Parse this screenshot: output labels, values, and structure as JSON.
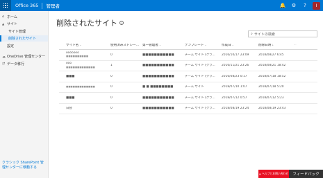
{
  "suite": {
    "brand": "Office 365",
    "app_title": "管理者",
    "bell_icon": "bell-icon",
    "gear_icon": "gear-icon",
    "help_icon": "question-icon",
    "avatar_initial": "I"
  },
  "nav": {
    "items": [
      {
        "label": "ホーム",
        "icon": "home-icon",
        "toggle": ""
      },
      {
        "label": "サイト",
        "icon": "",
        "toggle": "chevron-up-icon"
      },
      {
        "label": "サイト管理",
        "icon": "",
        "toggle": ""
      },
      {
        "label": "削除されたサイト",
        "icon": "",
        "toggle": ""
      },
      {
        "label": "設定",
        "icon": "",
        "toggle": ""
      },
      {
        "label": "OneDrive 管理センター",
        "icon": "onedrive-icon",
        "toggle": ""
      },
      {
        "label": "データ移行",
        "icon": "migration-icon",
        "toggle": ""
      }
    ],
    "classic_link": "クラシック SharePoint 管理センターに移動する"
  },
  "page": {
    "title": "削除されたサイト",
    "search_placeholder": "サイトの検索"
  },
  "grid": {
    "columns": [
      "サイト名",
      "使用済みストレー...",
      "第一管理者",
      "テンプレート",
      "作成日",
      "削除日時"
    ],
    "rows": [
      {
        "name": "ooooooo",
        "name_sub": "■■■■■■■■■■",
        "storage": "0",
        "admin": "■■■■■■■■■■■",
        "template": "チーム サイト (クラ...",
        "created": "2016/10/17 23:09",
        "deleted": "2018/08/27 6:45"
      },
      {
        "name": "ooo",
        "name_sub": "■■■■■■■■■■■■■",
        "storage": "1",
        "admin": "■■■■■■■■■■■",
        "template": "チーム サイト (クラ...",
        "created": "2016/11/21 23:26",
        "deleted": "2018/08/21 18:42"
      },
      {
        "name": "■■■",
        "name_sub": "",
        "storage": "0",
        "admin": "■■■■■■■■■■■",
        "template": "チーム サイト (クラ...",
        "created": "2016/08/23 0:17",
        "deleted": "2018/07/18 18:52"
      },
      {
        "name": "",
        "name_sub": "■■■■■■■■■■■■■",
        "storage": "0",
        "admin": "■ ■ ■■■■■■■■",
        "template": "チーム サイト",
        "created": "2018/07/10 1:07",
        "deleted": "2018/07/18 5:20"
      },
      {
        "name": "■■■",
        "name_sub": "",
        "storage": "0",
        "admin": "■■■■■■■■■■■",
        "template": "チーム サイト (クラ...",
        "created": "2018/07/12 0:57",
        "deleted": "2018/07/12 5:23"
      },
      {
        "name": "日替",
        "name_sub": "",
        "storage": "0",
        "admin": "■■■■■■■■■■■",
        "template": "チーム サイト (クラ...",
        "created": "2018/08/19 23:24",
        "deleted": "2018/08/19 23:43"
      }
    ]
  },
  "footer": {
    "help_label": "ヘルプとお問い合わせ",
    "feedback_label": "フィードバック"
  },
  "colors": {
    "suite_bar": "#0078d4",
    "help_button": "#e81123",
    "feedback_button": "#333333"
  }
}
